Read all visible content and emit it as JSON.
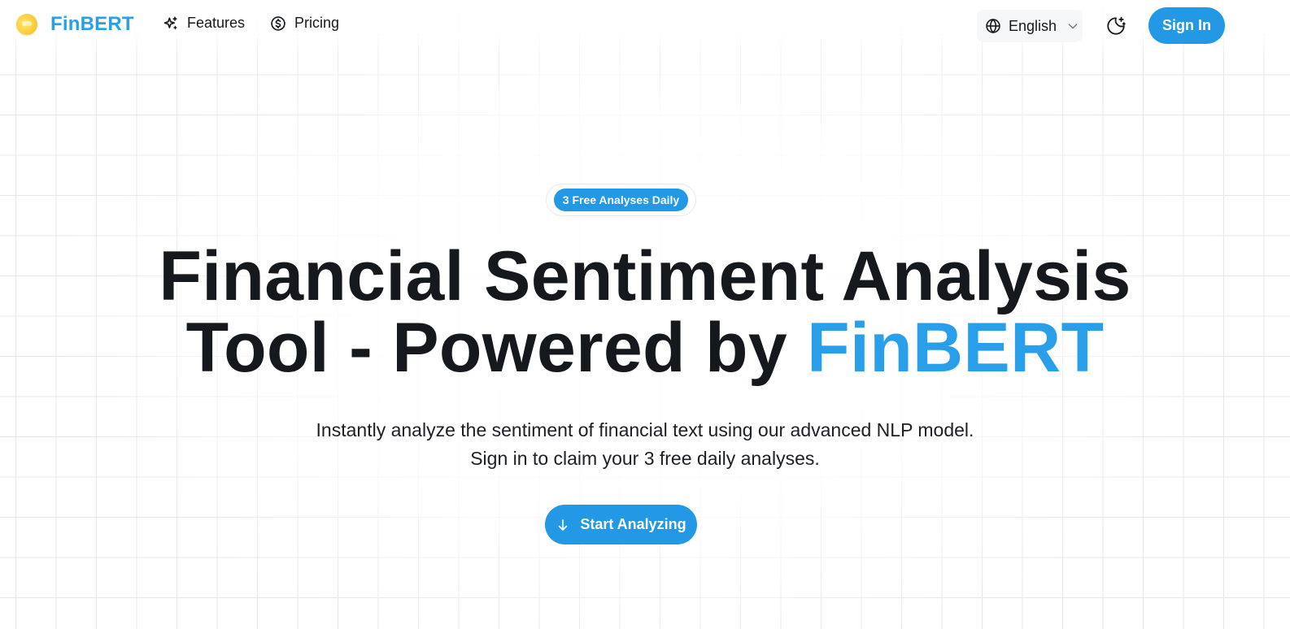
{
  "brand": {
    "name": "FinBERT",
    "logo_icon": "coin-logo-icon",
    "color": "#2a9fe9"
  },
  "nav": {
    "links": [
      {
        "label": "Features",
        "icon": "sparkles-icon"
      },
      {
        "label": "Pricing",
        "icon": "dollar-circle-icon"
      }
    ],
    "language": {
      "label": "English",
      "icon": "globe-icon",
      "chevron": "chevron-down-icon"
    },
    "theme_toggle_icon": "moon-stars-icon",
    "sign_in_label": "Sign In"
  },
  "hero": {
    "badge": "3 Free Analyses Daily",
    "title_main": "Financial Sentiment Analysis",
    "title_line2_prefix": "Tool - Powered by ",
    "title_highlight": "FinBERT",
    "subtitle_line1": "Instantly analyze the sentiment of financial text using our advanced NLP model.",
    "subtitle_line2": "Sign in to claim your 3 free daily analyses.",
    "cta_label": "Start Analyzing",
    "cta_icon": "arrow-down-icon"
  },
  "colors": {
    "accent": "#2399e6",
    "text": "#15181d",
    "grid": "#e6e7ea"
  }
}
